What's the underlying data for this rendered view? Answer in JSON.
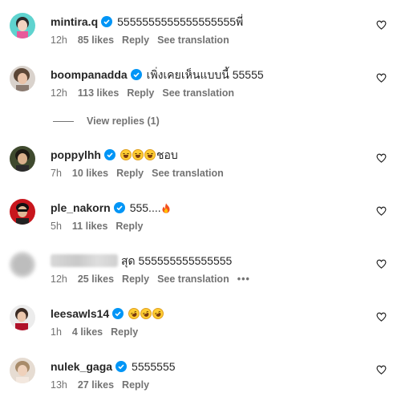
{
  "comments": [
    {
      "username": "mintira.q",
      "text": "5555555555555555555พี่",
      "time": "12h",
      "likes": "85 likes",
      "reply": "Reply",
      "translate": "See translation"
    },
    {
      "username": "boompanadda",
      "text": "เพิ่งเคยเห็นแบบนี้ 55555",
      "time": "12h",
      "likes": "113 likes",
      "reply": "Reply",
      "translate": "See translation"
    },
    {
      "username": "poppylhh",
      "text": "ชอบ",
      "emojis": [
        "grinning-face-with-sweat",
        "grinning-face-with-sweat",
        "grinning-face-with-sweat"
      ],
      "time": "7h",
      "likes": "10 likes",
      "reply": "Reply",
      "translate": "See translation"
    },
    {
      "username": "ple_nakorn",
      "text": "555....",
      "emojis": [
        "fire"
      ],
      "time": "5h",
      "likes": "11 likes",
      "reply": "Reply"
    },
    {
      "username": "",
      "text": "สุด 555555555555555",
      "time": "12h",
      "likes": "25 likes",
      "reply": "Reply",
      "translate": "See translation",
      "more": "•••"
    },
    {
      "username": "leesawls14",
      "text": "",
      "emojis": [
        "rolling-on-floor-laughing",
        "rolling-on-floor-laughing",
        "rolling-on-floor-laughing"
      ],
      "time": "1h",
      "likes": "4 likes",
      "reply": "Reply"
    },
    {
      "username": "nulek_gaga",
      "text": "5555555",
      "time": "13h",
      "likes": "27 likes",
      "reply": "Reply"
    }
  ],
  "view_replies": "View replies (1)",
  "icons": {
    "verified": "verified-badge-icon",
    "like": "heart-icon"
  },
  "colors": {
    "verified": "#0095f6",
    "secondary_text": "#737373",
    "primary_text": "#262626"
  }
}
